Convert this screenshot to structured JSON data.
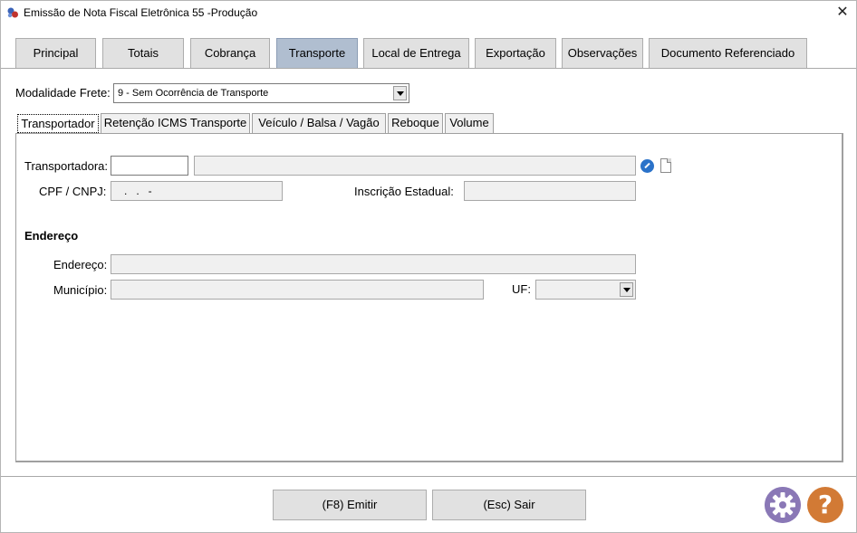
{
  "window": {
    "title": "Emissão de Nota Fiscal Eletrônica 55 -Produção",
    "close_glyph": "✕"
  },
  "main_tabs": [
    {
      "label": "Principal"
    },
    {
      "label": "Totais"
    },
    {
      "label": "Cobrança"
    },
    {
      "label": "Transporte",
      "active": true
    },
    {
      "label": "Local de Entrega"
    },
    {
      "label": "Exportação"
    },
    {
      "label": "Observações"
    },
    {
      "label": "Documento Referenciado"
    }
  ],
  "modalidade": {
    "label": "Modalidade Frete:",
    "value": "9 - Sem Ocorrência de Transporte"
  },
  "sub_tabs": [
    {
      "label": "Transportador",
      "active": true
    },
    {
      "label": "Retenção ICMS Transporte"
    },
    {
      "label": "Veículo / Balsa / Vagão"
    },
    {
      "label": "Reboque"
    },
    {
      "label": "Volume"
    }
  ],
  "transportador": {
    "transportadora_label": "Transportadora:",
    "transportadora_code": "",
    "transportadora_name": "",
    "cpf_label": "CPF / CNPJ:",
    "cpf_value": "   .   .   -",
    "ie_label": "Inscrição Estadual:",
    "ie_value": ""
  },
  "endereco": {
    "section_title": "Endereço",
    "endereco_label": "Endereço:",
    "endereco_value": "",
    "municipio_label": "Município:",
    "municipio_value": "",
    "uf_label": "UF:",
    "uf_value": ""
  },
  "footer": {
    "emitir_label": "(F8) Emitir",
    "sair_label": "(Esc) Sair",
    "help_glyph": "?"
  },
  "icons": {
    "settings": "gear-icon",
    "help": "help-icon",
    "edit": "edit-icon",
    "new_document": "document-icon"
  },
  "colors": {
    "active_tab": "#b0bed0",
    "gear": "#8a78b6",
    "help": "#d27a35",
    "edit": "#2a72c9"
  }
}
